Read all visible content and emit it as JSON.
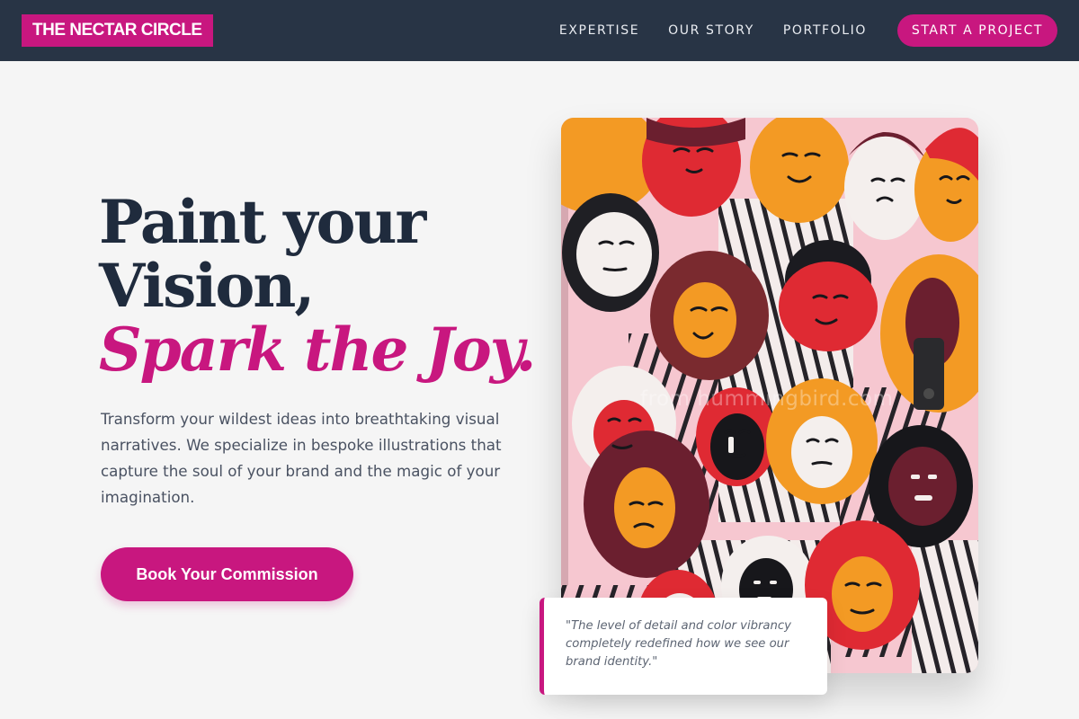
{
  "brand": {
    "logo_text": "THE NECTAR CIRCLE",
    "accent_color": "#c8177f",
    "navbar_color": "#283445"
  },
  "nav": {
    "items": [
      {
        "label": "EXPERTISE"
      },
      {
        "label": "OUR STORY"
      },
      {
        "label": "PORTFOLIO"
      }
    ],
    "cta_label": "START A PROJECT"
  },
  "hero": {
    "title_line1": "Paint your",
    "title_line2": "Vision,",
    "title_accent": "Spark the Joy.",
    "description": "Transform your wildest ideas into breathtaking visual narratives. We specialize in bespoke illustrations that capture the soul of your brand and the magic of your imagination.",
    "button_label": "Book Your Commission"
  },
  "testimonial": {
    "quote": "\"The level of detail and color vibrancy completely redefined how we see our brand identity.\""
  },
  "artwork": {
    "watermark": "from hummingbird.com",
    "description_colors": {
      "pink": "#f6c7d0",
      "red": "#df2a33",
      "orange": "#f39a24",
      "maroon": "#6b1f2f",
      "black": "#17171b",
      "white": "#f4efed"
    }
  }
}
